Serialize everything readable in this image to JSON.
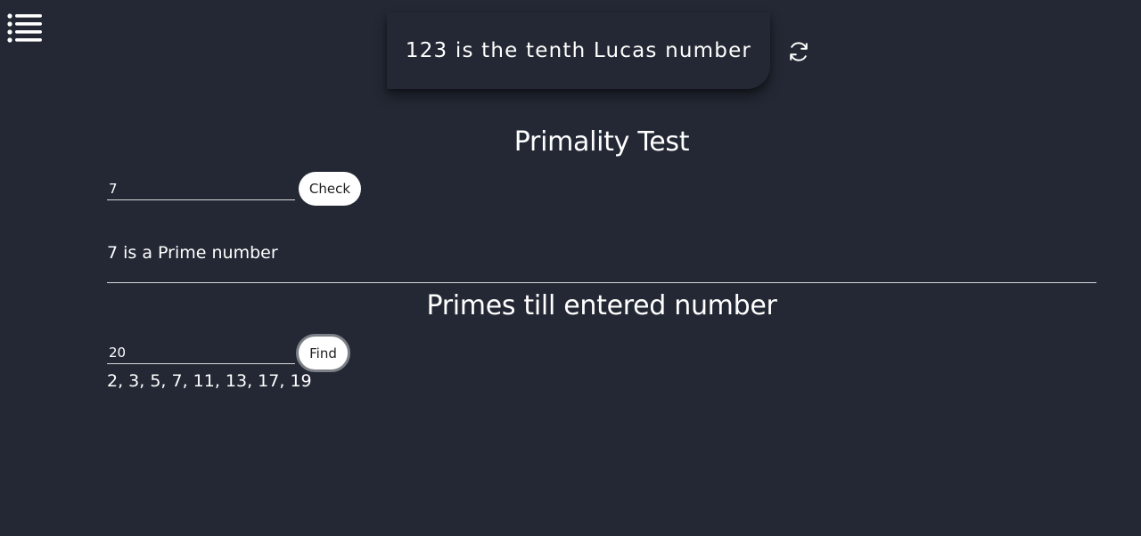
{
  "header": {
    "menu_icon": "list-menu-icon",
    "fact": "123 is the tenth Lucas number",
    "refresh_icon": "refresh-icon"
  },
  "primality": {
    "title": "Primality Test",
    "input_value": "7",
    "button_label": "Check",
    "result": "7 is a Prime number"
  },
  "primes": {
    "title": "Primes till entered number",
    "input_value": "20",
    "button_label": "Find",
    "result": "2, 3, 5, 7, 11, 13, 17, 19"
  },
  "colors": {
    "background": "#232834",
    "text": "#ffffff",
    "button_bg": "#ffffff",
    "button_text": "#1e1e1e",
    "focus_ring": "#7c7f86"
  }
}
